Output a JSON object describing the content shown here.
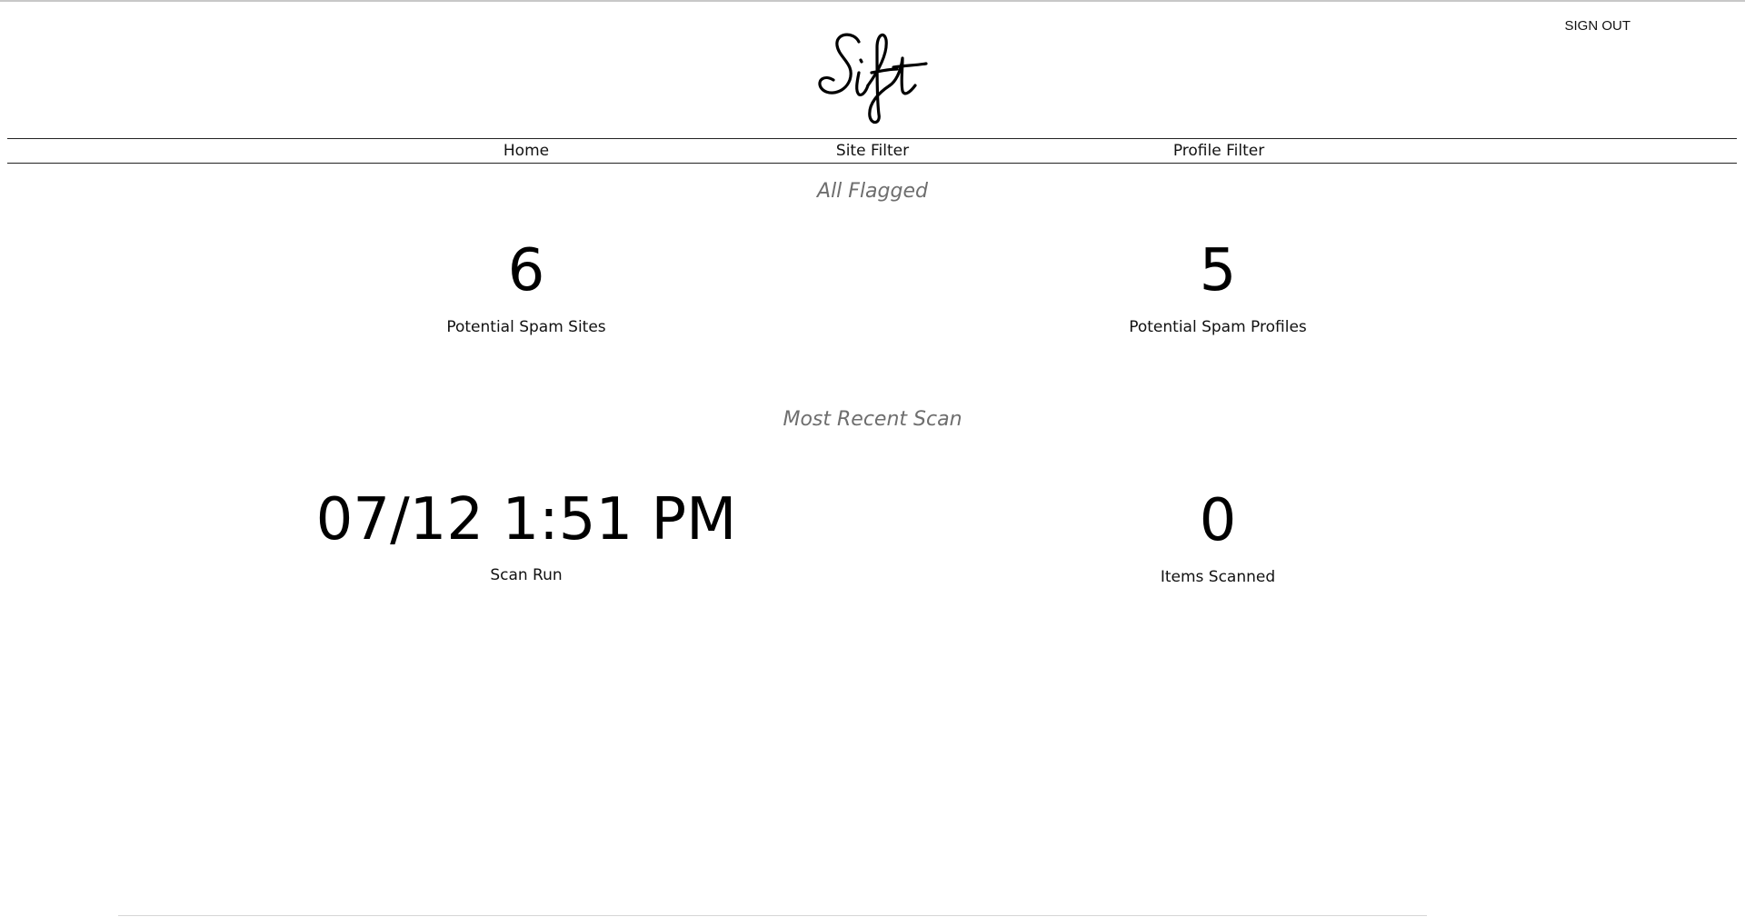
{
  "header": {
    "logo_text": "Sift",
    "sign_out_label": "SIGN OUT"
  },
  "nav": {
    "items": [
      {
        "label": "Home"
      },
      {
        "label": "Site Filter"
      },
      {
        "label": "Profile Filter"
      }
    ]
  },
  "all_flagged": {
    "title": "All Flagged",
    "stats": [
      {
        "value": "6",
        "label": "Potential Spam Sites"
      },
      {
        "value": "5",
        "label": "Potential Spam Profiles"
      }
    ]
  },
  "most_recent_scan": {
    "title": "Most Recent Scan",
    "stats": [
      {
        "value": "07/12 1:51 PM",
        "label": "Scan Run"
      },
      {
        "value": "0",
        "label": "Items Scanned"
      }
    ]
  }
}
